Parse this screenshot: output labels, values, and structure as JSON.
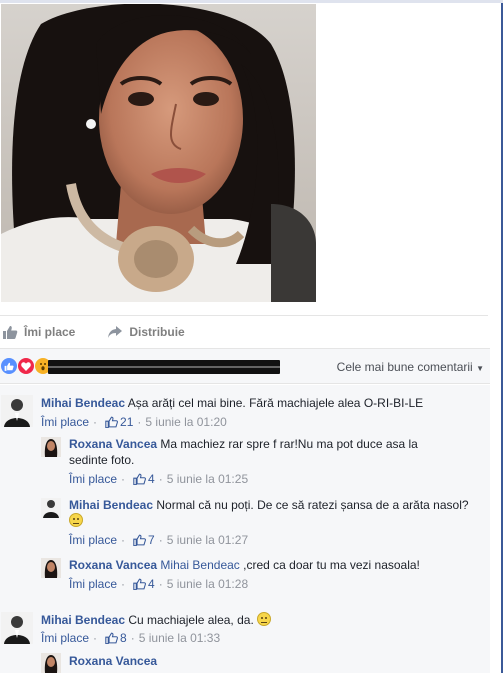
{
  "actions": {
    "like_label": "Îmi place",
    "share_label": "Distribuie"
  },
  "reactions": {
    "sort_label": "Cele mai bune comentarii"
  },
  "comments": [
    {
      "author": "Mihai Bendeac",
      "text": "Așa arăți cel mai bine. Fără machiajele alea O-RI-BI-LE",
      "like_label": "Îmi place",
      "likes": "21",
      "time": "5 iunie la 01:20"
    },
    {
      "author": "Roxana Vancea",
      "text": "Ma machiez rar spre f rar!Nu ma pot duce asa la sedinte foto.",
      "like_label": "Îmi place",
      "likes": "4",
      "time": "5 iunie la 01:25"
    },
    {
      "author": "Mihai Bendeac",
      "text": "Normal că nu poți. De ce să ratezi șansa de a arăta nasol?",
      "like_label": "Îmi place",
      "likes": "7",
      "time": "5 iunie la 01:27"
    },
    {
      "author": "Roxana Vancea",
      "mention": "Mihai Bendeac",
      "text": " ,cred ca doar tu ma vezi nasoala!",
      "like_label": "Îmi place",
      "likes": "4",
      "time": "5 iunie la 01:28"
    },
    {
      "author": "Mihai Bendeac",
      "text": "Cu machiajele alea, da.",
      "like_label": "Îmi place",
      "likes": "8",
      "time": "5 iunie la 01:33"
    },
    {
      "author": "Roxana Vancea"
    }
  ],
  "colors": {
    "link": "#365899",
    "meta": "#90949c",
    "like_blue": "#5890ff",
    "love_red": "#f0284a",
    "wow_yellow": "#f7b125"
  },
  "icons": [
    "thumbs-up-icon",
    "share-arrow-icon",
    "like-reaction-icon",
    "love-reaction-icon",
    "wow-reaction-icon",
    "chevron-down-icon",
    "smile-emoji-icon"
  ]
}
